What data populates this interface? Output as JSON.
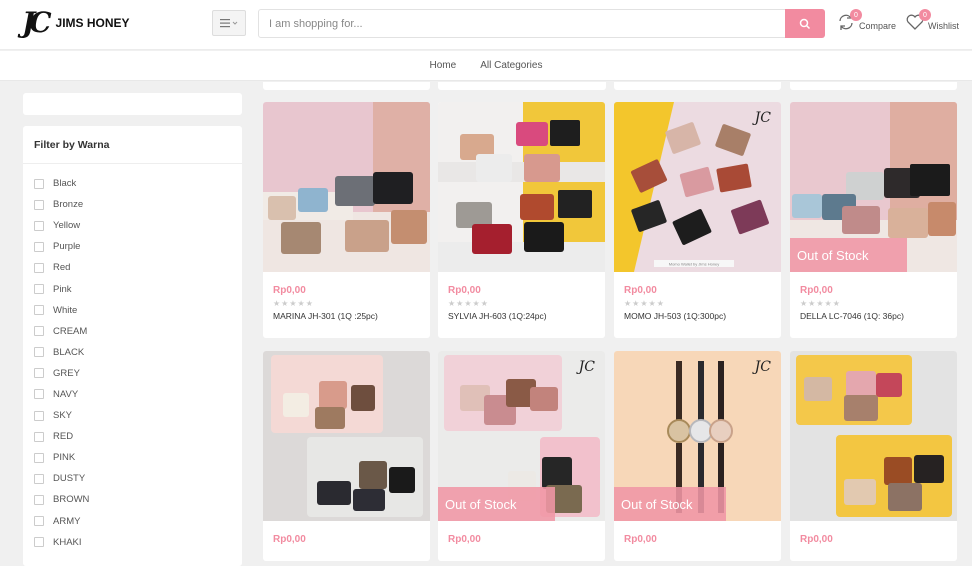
{
  "header": {
    "logo_text": "JIMS HONEY",
    "search_placeholder": "I am shopping for...",
    "compare_label": "Compare",
    "compare_count": "0",
    "wishlist_label": "Wishlist",
    "wishlist_count": "0",
    "accent_color": "#f28ba0"
  },
  "nav": {
    "home": "Home",
    "all_categories": "All Categories"
  },
  "filter": {
    "title": "Filter by Warna",
    "options": [
      "Black",
      "Bronze",
      "Yellow",
      "Purple",
      "Red",
      "Pink",
      "White",
      "CREAM",
      "BLACK",
      "GREY",
      "NAVY",
      "SKY",
      "RED",
      "PINK",
      "DUSTY",
      "BROWN",
      "ARMY",
      "KHAKI"
    ]
  },
  "products": [
    {
      "price": "Rp0,00",
      "name": "MARINA JH-301 (1Q :25pc)",
      "out_of_stock": false,
      "stars": "★★★★★"
    },
    {
      "price": "Rp0,00",
      "name": "SYLVIA JH-603 (1Q:24pc)",
      "out_of_stock": false,
      "stars": "★★★★★"
    },
    {
      "price": "Rp0,00",
      "name": "MOMO JH-503 (1Q:300pc)",
      "out_of_stock": false,
      "stars": "★★★★★"
    },
    {
      "price": "Rp0,00",
      "name": "DELLA LC-7046 (1Q: 36pc)",
      "out_of_stock": true,
      "stars": "★★★★★"
    },
    {
      "price": "Rp0,00",
      "out_of_stock": false
    },
    {
      "price": "Rp0,00",
      "out_of_stock": true
    },
    {
      "price": "Rp0,00",
      "out_of_stock": true
    },
    {
      "price": "Rp0,00",
      "out_of_stock": false
    }
  ],
  "labels": {
    "out_of_stock": "Out of Stock",
    "watermark": "JC",
    "photo_caption": "Momo Wallet by Jims Honey"
  }
}
